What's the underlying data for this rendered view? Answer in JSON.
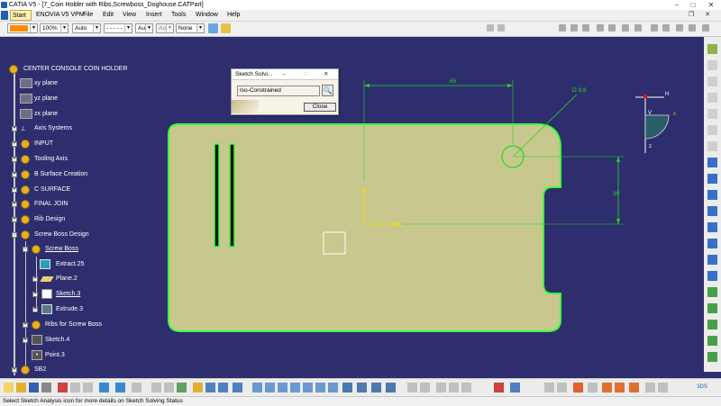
{
  "window": {
    "title": "CATIA V5 - [7_Coin Holder with Ribs,Screwboss_Doghouse.CATPart]",
    "min": "–",
    "max": "□",
    "close": "✕"
  },
  "menu": [
    "Start",
    "ENOVIA V5 VPM",
    "File",
    "Edit",
    "View",
    "Insert",
    "Tools",
    "Window",
    "Help"
  ],
  "toolbar": {
    "zoom": "100%",
    "combo_auto1": "Auto",
    "combo_linetype": "- - - - -",
    "combo_auto2": "Aut",
    "combo_auto3": "Aut",
    "combo_none": "None"
  },
  "tree": {
    "root": "CENTER CONSOLE COIN HOLDER",
    "items": [
      "xy plane",
      "yz plane",
      "zx plane",
      "Axis Systems",
      "INPUT",
      "Tooling Axis",
      "B Surface Creation",
      "C SURFACE",
      "FINAL JOIN",
      "Rib Design",
      "Screw Boss Design",
      "Screw Boss",
      "Extract.25",
      "Plane.2",
      "Sketch.3",
      "Extrude.3",
      "Ribs for Screw Boss",
      "Sketch.4",
      "Point.3",
      "SB2"
    ]
  },
  "dialog": {
    "title": "Sketch Solvi...",
    "status": "Iso-Constrained",
    "close_button": "Close"
  },
  "sketch": {
    "dim_width": "65",
    "dim_diameter": "D 9.8",
    "dim_height": "30",
    "axis_h": "H",
    "axis_x": "x",
    "axis_v": "V",
    "axis_z": "z"
  },
  "status": {
    "text": "Select Sketch Analysis icon for more details on Sketch Solving Status"
  },
  "colors": {
    "background": "#2e2e6e",
    "part_fill": "#c8c88e",
    "constraint_green": "#22d822",
    "highlight_green": "#3cff3c",
    "axis_yellow": "#f0e000"
  }
}
